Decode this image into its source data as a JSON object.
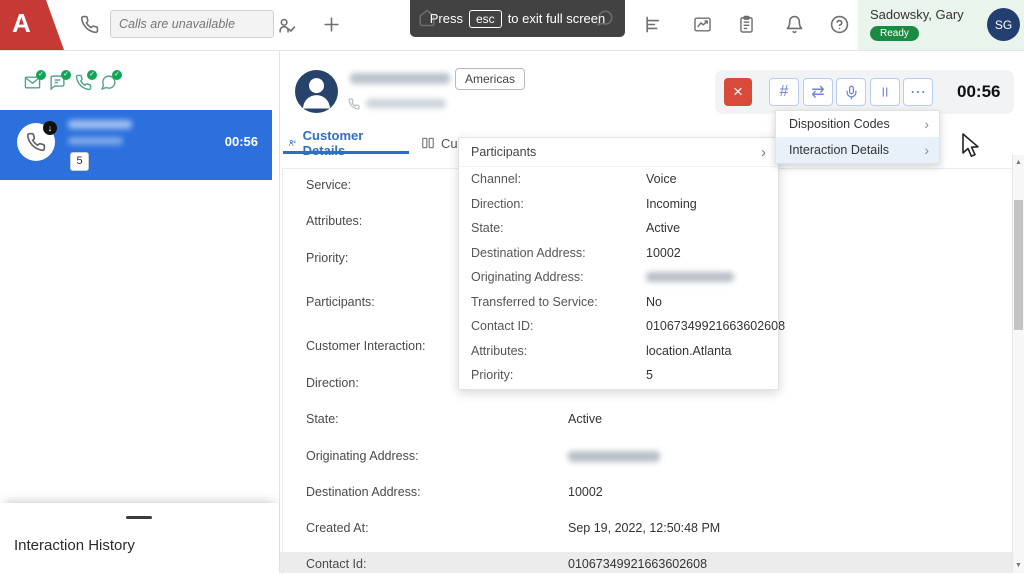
{
  "topbar": {
    "logo_letter": "A",
    "call_search_placeholder": "Calls are unavailable",
    "toast": {
      "prefix": "Press",
      "key": "esc",
      "suffix": "to exit full screen"
    },
    "user": {
      "name": "Sadowsky, Gary",
      "status": "Ready",
      "initials": "SG"
    }
  },
  "sidebar": {
    "active_call": {
      "timer": "00:56",
      "badge": "5"
    },
    "interaction_history": "Interaction History"
  },
  "header": {
    "region": "Americas"
  },
  "tabs": [
    {
      "label": "Customer Details"
    },
    {
      "label": "Cust"
    }
  ],
  "controls": {
    "timer": "00:56"
  },
  "menu": {
    "items": [
      {
        "label": "Disposition Codes"
      },
      {
        "label": "Interaction Details",
        "highlighted": true
      }
    ]
  },
  "popup": {
    "title": "Participants",
    "rows": [
      {
        "label": "Channel:",
        "value": "Voice"
      },
      {
        "label": "Direction:",
        "value": "Incoming"
      },
      {
        "label": "State:",
        "value": "Active"
      },
      {
        "label": "Destination Address:",
        "value": "10002"
      },
      {
        "label": "Originating Address:",
        "value": "",
        "blurred": true
      },
      {
        "label": "Transferred to Service:",
        "value": "No"
      },
      {
        "label": "Contact ID:",
        "value": "01067349921663602608"
      },
      {
        "label": "Attributes:",
        "value": "location.Atlanta"
      },
      {
        "label": "Priority:",
        "value": "5"
      }
    ]
  },
  "fields": [
    {
      "label": "Service:",
      "value": ""
    },
    {
      "label": "Attributes:",
      "value": ""
    },
    {
      "label": "Priority:",
      "value": ""
    },
    {
      "label": "Participants:",
      "value": ""
    },
    {
      "label": "Customer Interaction:",
      "value": ""
    },
    {
      "label": "Direction:",
      "value": "Incoming"
    },
    {
      "label": "State:",
      "value": "Active"
    },
    {
      "label": "Originating Address:",
      "value": "",
      "blurred": true
    },
    {
      "label": "Destination Address:",
      "value": "10002"
    },
    {
      "label": "Created At:",
      "value": "Sep 19, 2022, 12:50:48 PM"
    },
    {
      "label": "Contact Id:",
      "value": "01067349921663602608"
    }
  ],
  "icons": {
    "hash": "#",
    "transfer": "⇄",
    "ellipsis": "⋯",
    "close": "×",
    "chevron": "›",
    "check": "✓",
    "incoming_arrow": "↓",
    "up_arrow": "▲",
    "down_arrow": "▼"
  }
}
